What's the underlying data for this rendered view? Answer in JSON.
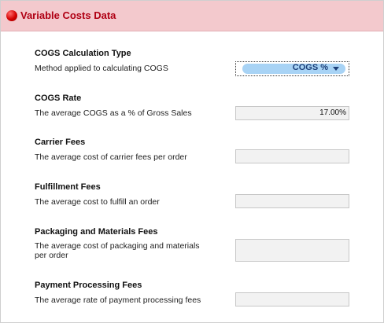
{
  "header": {
    "title": "Variable Costs Data"
  },
  "sections": {
    "cogs_type": {
      "title": "COGS Calculation Type",
      "description": "Method applied to calculating COGS",
      "selected": "COGS %"
    },
    "cogs_rate": {
      "title": "COGS Rate",
      "description": "The average COGS as a % of Gross Sales",
      "value": "17.00%"
    },
    "carrier_fees": {
      "title": "Carrier Fees",
      "description": "The average cost of carrier fees per order",
      "value": ""
    },
    "fulfillment_fees": {
      "title": "Fulfillment Fees",
      "description": "The average cost to fulfill an order",
      "value": ""
    },
    "packaging_fees": {
      "title": "Packaging and Materials Fees",
      "description_line1": "The average cost of packaging and materials",
      "description_line2": "per order",
      "value": ""
    },
    "payment_fees": {
      "title": "Payment Processing Fees",
      "description": "The average rate of payment processing fees",
      "value": ""
    }
  },
  "colors": {
    "header_bg": "#f3c9cd",
    "header_text": "#b00014",
    "dropdown_pill": "#a8d3f5",
    "dropdown_text": "#1b3f78"
  },
  "icons": {
    "header_icon": "red-dot-icon"
  }
}
